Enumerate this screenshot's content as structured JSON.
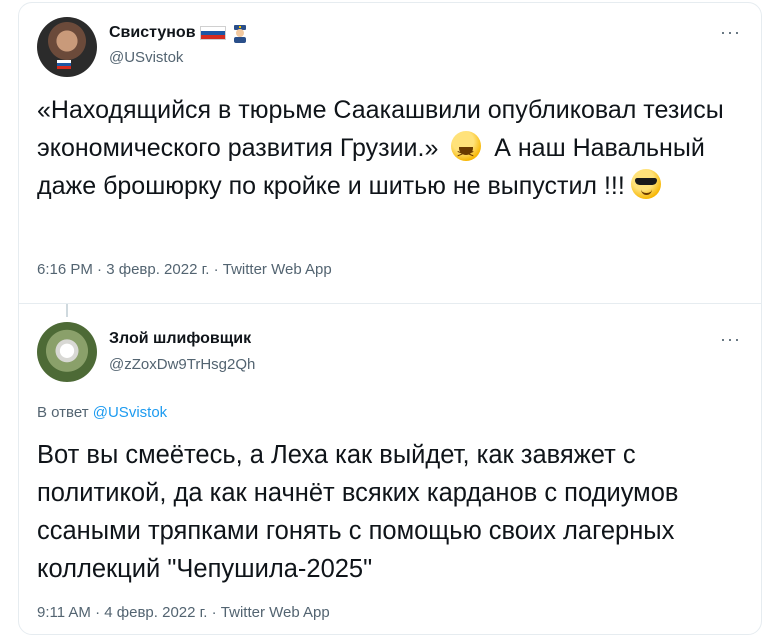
{
  "tweets": [
    {
      "display_name": "Свистунов",
      "handle": "@USvistok",
      "more": "···",
      "avatar_icon": "portrait-avatar",
      "badges": [
        "russia-flag-icon",
        "police-officer-icon"
      ],
      "text_parts": [
        "«Находящийся в тюрьме Саакашвили опубликовал тезисы экономического развития Грузии.»",
        "А наш Навальный даже брошюрку по кройке и шитью не выпустил !!!"
      ],
      "emojis": [
        "grinning-squinting-face",
        "smiling-face-with-sunglasses"
      ],
      "time": "6:16 PM",
      "date": "3 февр. 2022 г.",
      "source": "Twitter Web App",
      "separator": " · "
    },
    {
      "display_name": "Злой шлифовщик",
      "handle": "@zZoxDw9TrHsg2Qh",
      "more": "···",
      "avatar_icon": "cat-avatar",
      "reply_prefix": "В ответ",
      "reply_handle": "@USvistok",
      "text": "Вот вы смеётесь, а Леха как выйдет, как завяжет с политикой, да как начнёт всяких карданов с подиумов ссаными тряпками гонять с помощью своих лагерных коллекций \"Чепушила-2025\"",
      "time": "9:11 AM",
      "date": "4 февр. 2022 г.",
      "source": "Twitter Web App",
      "separator": " · "
    }
  ],
  "colors": {
    "text": "#0f1419",
    "muted": "#536471",
    "link": "#1d9bf0",
    "border": "#e6ecf0"
  }
}
